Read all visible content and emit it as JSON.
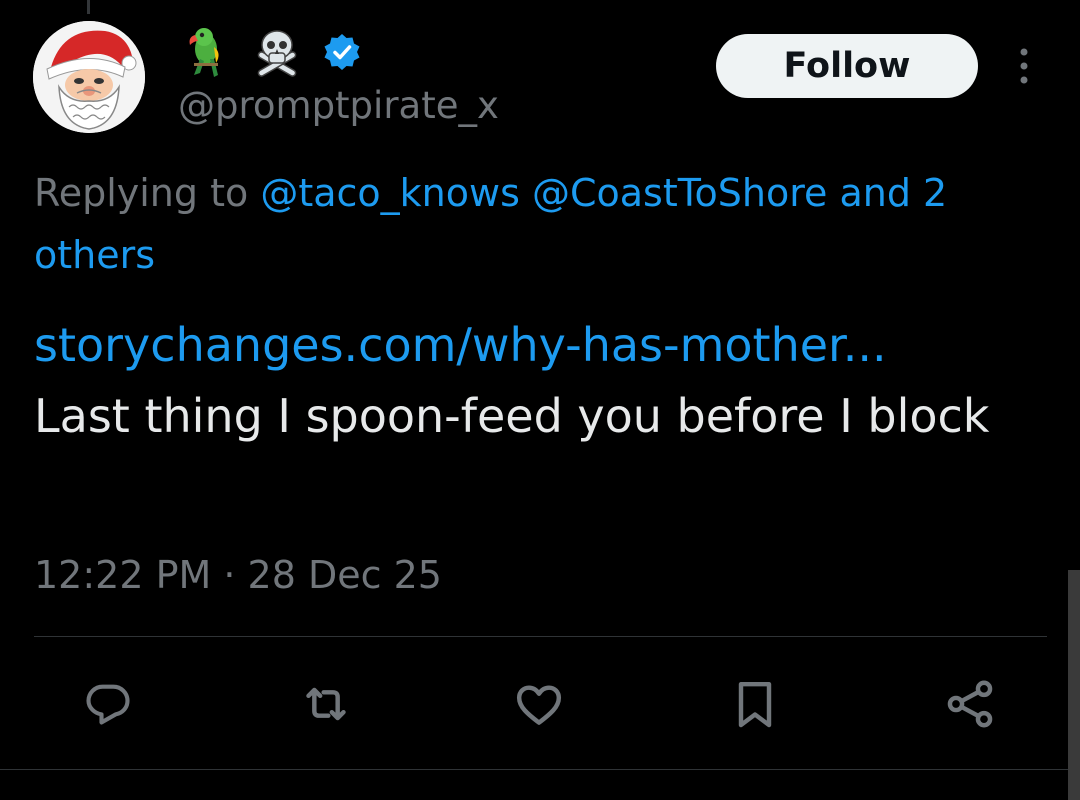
{
  "author": {
    "handle": "@promptpirate_x",
    "display_name_emojis": [
      "parrot-emoji",
      "skull-crossbones-emoji"
    ],
    "verified": true
  },
  "follow_button": {
    "label": "Follow"
  },
  "reply_context": {
    "prefix": "Replying to",
    "mentions": [
      "@taco_knows",
      "@CoastToShore"
    ],
    "suffix_joiner": "and",
    "others_count_text": "2",
    "others_label": "others"
  },
  "tweet": {
    "link_text": "storychanges.com/why-has-mother...",
    "text": "Last thing I spoon-feed you before I block",
    "timestamp": "12:22 PM · 28 Dec 25"
  },
  "actions": [
    {
      "icon": "reply-icon"
    },
    {
      "icon": "retweet-icon"
    },
    {
      "icon": "like-icon"
    },
    {
      "icon": "bookmark-icon"
    },
    {
      "icon": "share-icon"
    }
  ],
  "colors": {
    "background": "#000000",
    "text_primary": "#e7e9ea",
    "text_secondary": "#71767b",
    "accent_blue": "#1d9bf0",
    "follow_button_bg": "#eff3f4",
    "follow_button_text": "#0f1419",
    "divider": "#2f3336"
  }
}
